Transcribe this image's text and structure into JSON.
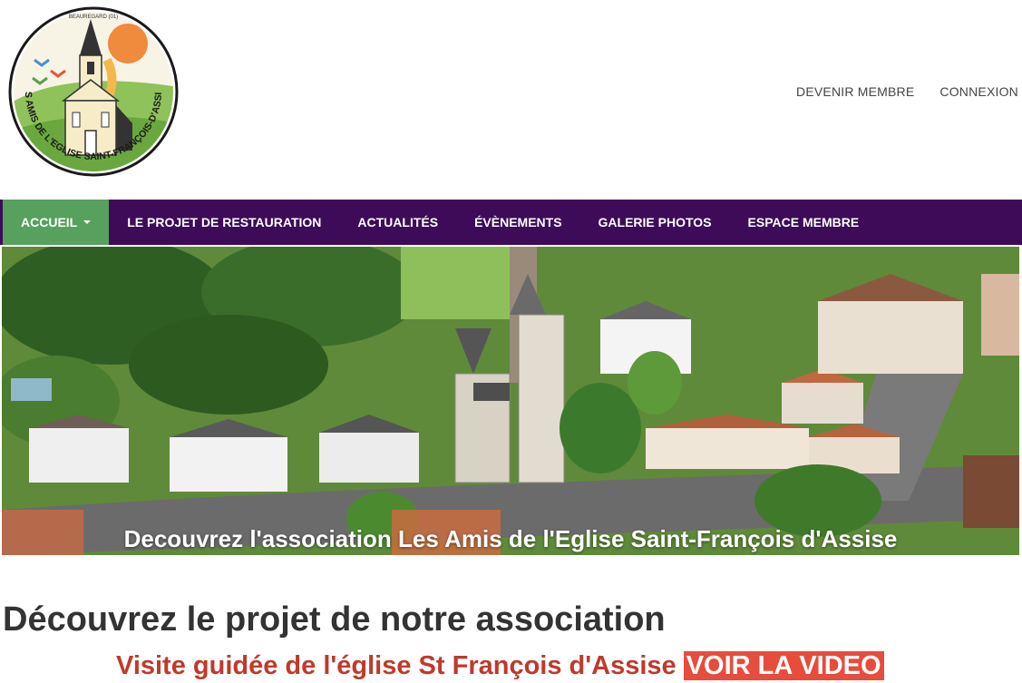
{
  "header": {
    "logo": {
      "arc_text": "LES AMIS DE L'EGLISE SAINT-FRANÇOIS-D'ASSISE",
      "top_text": "BEAUREGARD (01)",
      "alt": "church-logo"
    },
    "links": [
      {
        "label": "DEVENIR MEMBRE"
      },
      {
        "label": "CONNEXION"
      }
    ]
  },
  "nav": {
    "items": [
      {
        "label": "ACCUEIL",
        "active": true,
        "has_caret": true
      },
      {
        "label": "LE PROJET DE RESTAURATION"
      },
      {
        "label": "ACTUALITÉS"
      },
      {
        "label": "ÉVÈNEMENTS"
      },
      {
        "label": "GALERIE PHOTOS"
      },
      {
        "label": "ESPACE MEMBRE"
      }
    ],
    "bg_color": "#3e0b59",
    "active_color": "#58a05d"
  },
  "hero": {
    "caption": "Decouvrez l'association Les Amis de l'Eglise Saint-François d'Assise"
  },
  "content": {
    "title": "Découvrez le projet de notre association",
    "visit_text": "Visite guidée de l'église St François d'Assise",
    "video_label": "VOIR LA VIDEO",
    "accent_color": "#c0392b",
    "button_color": "#e74c3c"
  }
}
